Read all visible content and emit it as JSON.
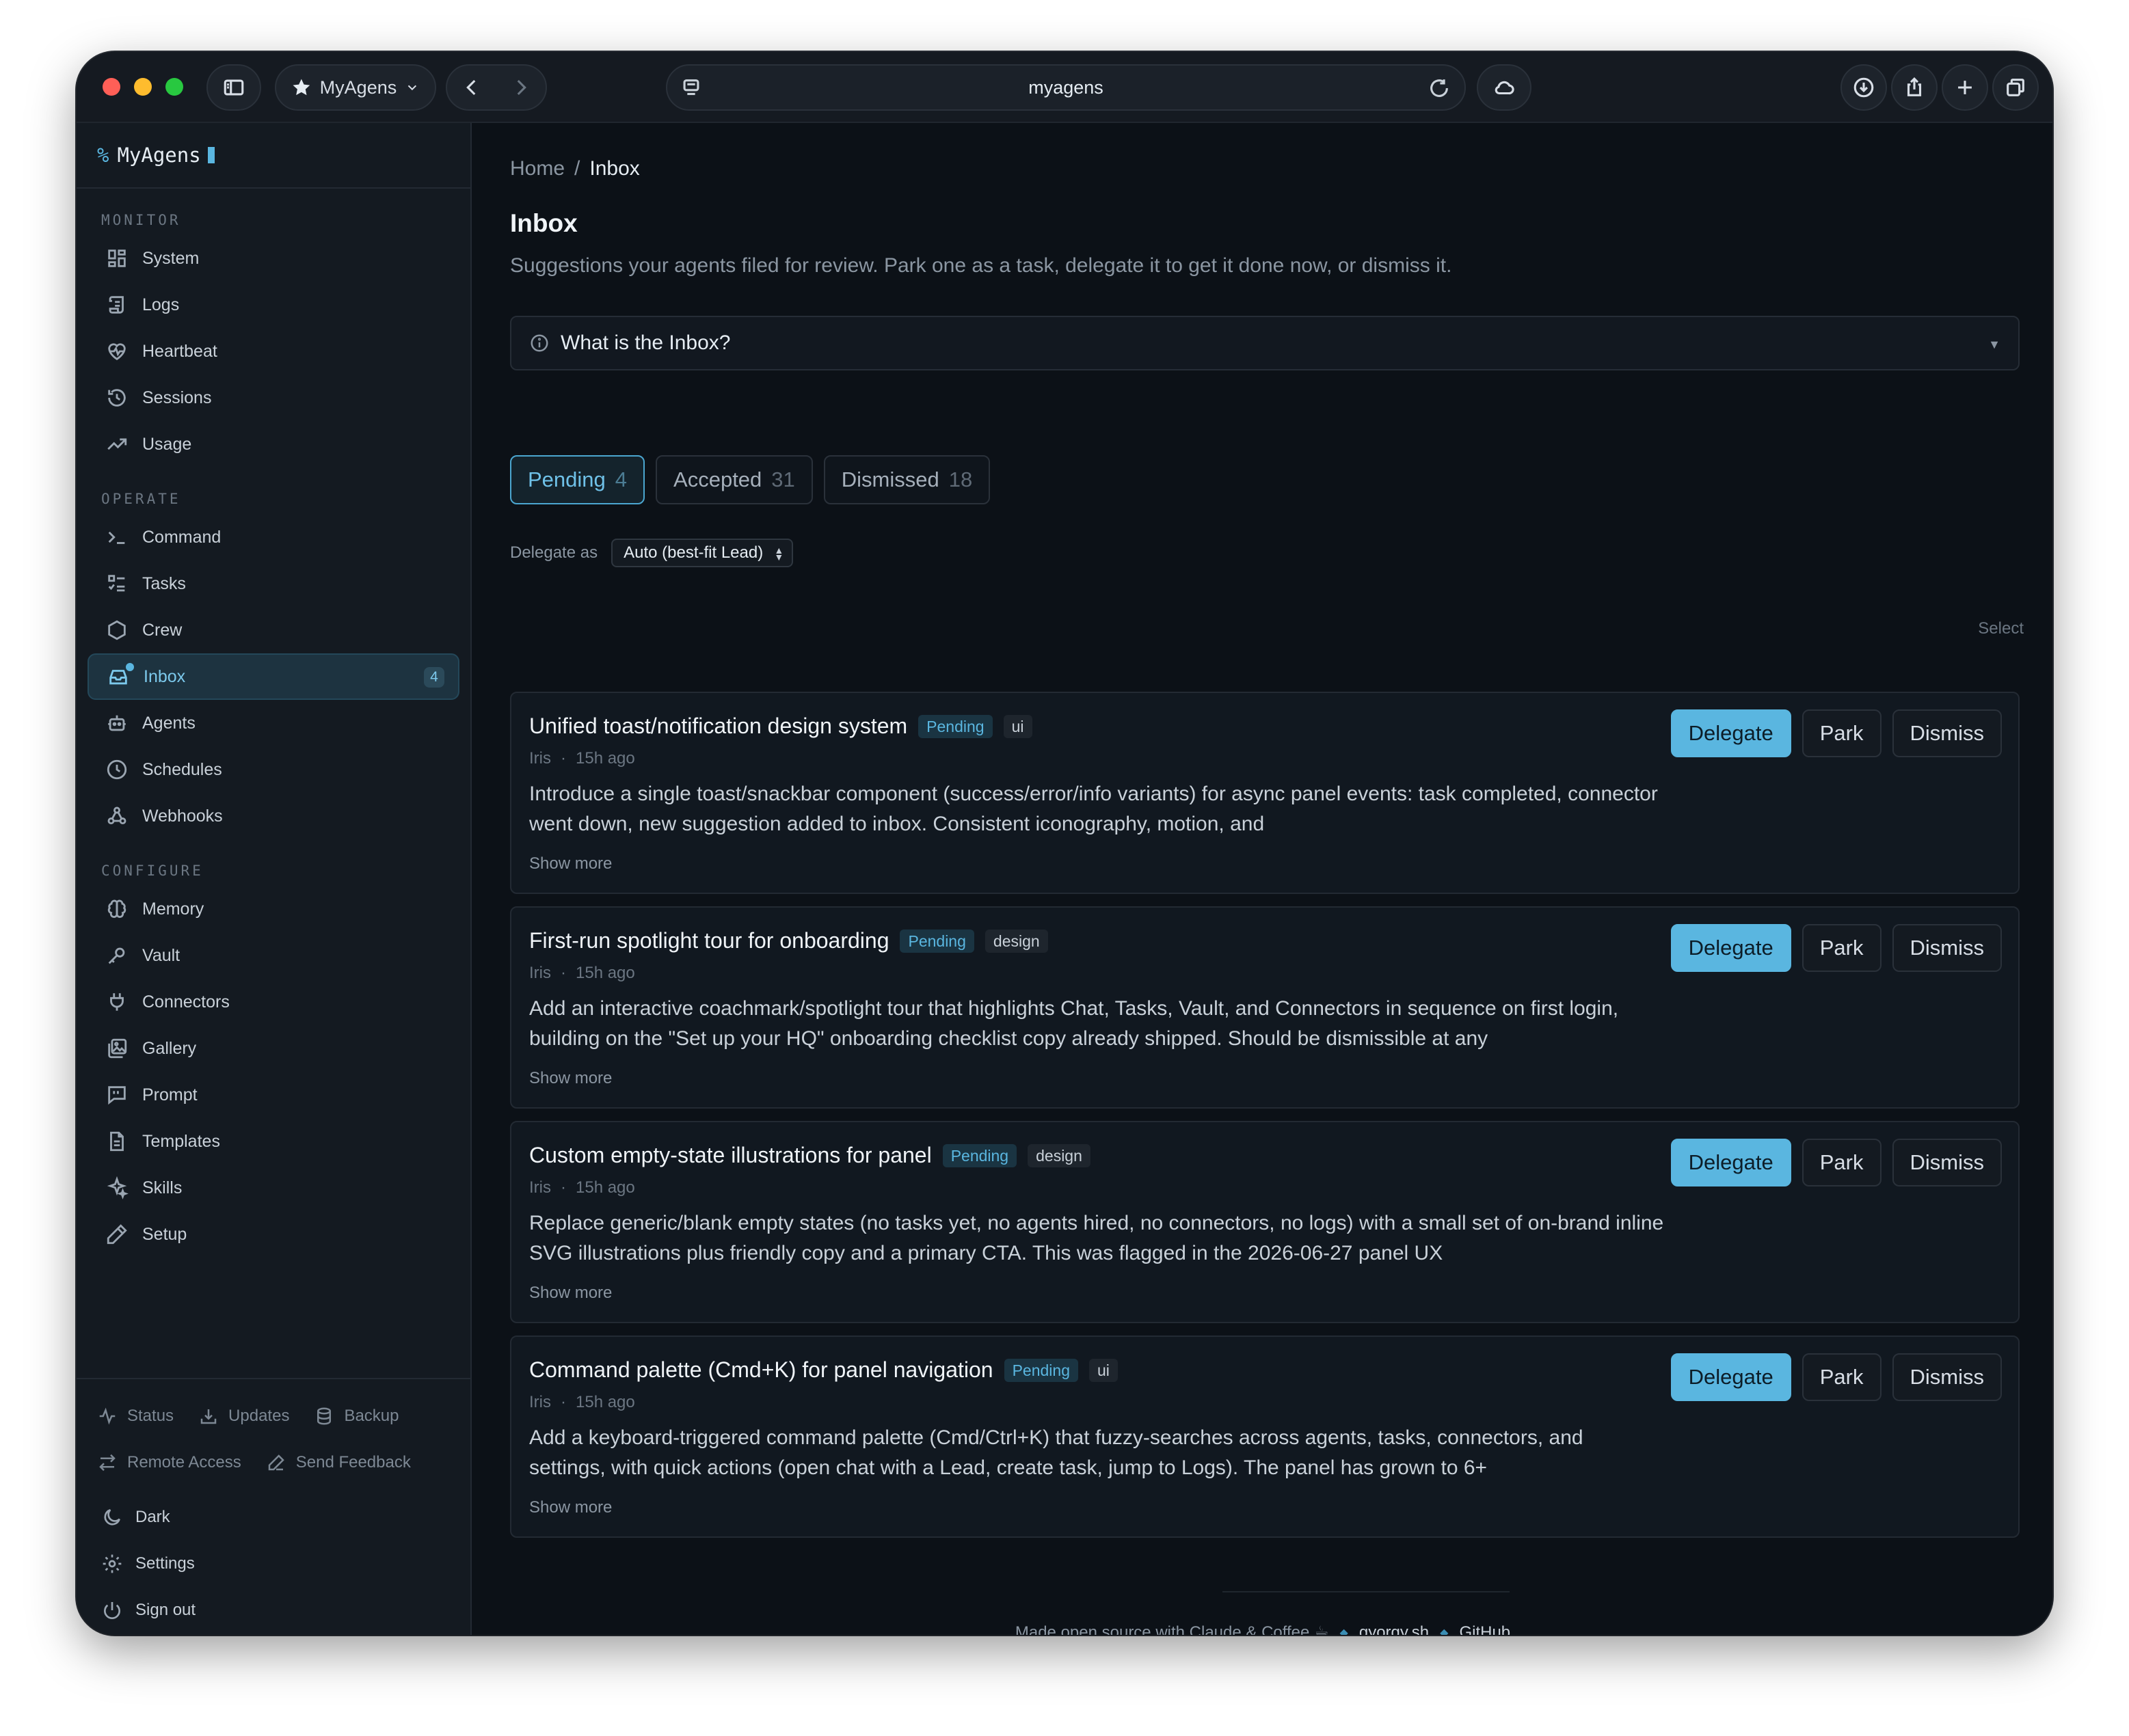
{
  "browser": {
    "profile_label": "MyAgens",
    "url": "myagens"
  },
  "sidebar": {
    "brand": "MyAgens",
    "sections": {
      "monitor": "MONITOR",
      "operate": "OPERATE",
      "configure": "CONFIGURE"
    },
    "monitor_items": [
      "System",
      "Logs",
      "Heartbeat",
      "Sessions",
      "Usage"
    ],
    "operate_items": [
      "Command",
      "Tasks",
      "Crew",
      "Inbox",
      "Agents",
      "Schedules",
      "Webhooks"
    ],
    "configure_items": [
      "Memory",
      "Vault",
      "Connectors",
      "Gallery",
      "Prompt",
      "Templates",
      "Skills",
      "Setup"
    ],
    "inbox_count": "4",
    "footer": {
      "status": "Status",
      "updates": "Updates",
      "backup": "Backup",
      "remote_access": "Remote Access",
      "send_feedback": "Send Feedback",
      "dark": "Dark",
      "settings": "Settings",
      "sign_out": "Sign out"
    }
  },
  "main": {
    "breadcrumb": {
      "home": "Home",
      "sep": "/",
      "current": "Inbox"
    },
    "title": "Inbox",
    "subtitle": "Suggestions your agents filed for review. Park one as a task, delegate it to get it done now, or dismiss it.",
    "info_title": "What is the Inbox?",
    "tabs": [
      {
        "label": "Pending",
        "count": "4"
      },
      {
        "label": "Accepted",
        "count": "31"
      },
      {
        "label": "Dismissed",
        "count": "18"
      }
    ],
    "delegate_label": "Delegate as",
    "delegate_value": "Auto (best-fit Lead)",
    "select_label": "Select",
    "buttons": {
      "delegate": "Delegate",
      "park": "Park",
      "dismiss": "Dismiss",
      "show_more": "Show more"
    },
    "cards": [
      {
        "title": "Unified toast/notification design system",
        "status": "Pending",
        "tag": "ui",
        "author": "Iris",
        "time": "15h ago",
        "description": "Introduce a single toast/snackbar component (success/error/info variants) for async panel events: task completed, connector went down, new suggestion added to inbox. Consistent iconography, motion, and"
      },
      {
        "title": "First-run spotlight tour for onboarding",
        "status": "Pending",
        "tag": "design",
        "author": "Iris",
        "time": "15h ago",
        "description": "Add an interactive coachmark/spotlight tour that highlights Chat, Tasks, Vault, and Connectors in sequence on first login, building on the \"Set up your HQ\" onboarding checklist copy already shipped. Should be dismissible at any"
      },
      {
        "title": "Custom empty-state illustrations for panel",
        "status": "Pending",
        "tag": "design",
        "author": "Iris",
        "time": "15h ago",
        "description": "Replace generic/blank empty states (no tasks yet, no agents hired, no connectors, no logs) with a small set of on-brand inline SVG illustrations plus friendly copy and a primary CTA. This was flagged in the 2026-06-27 panel UX"
      },
      {
        "title": "Command palette (Cmd+K) for panel navigation",
        "status": "Pending",
        "tag": "ui",
        "author": "Iris",
        "time": "15h ago",
        "description": "Add a keyboard-triggered command palette (Cmd/Ctrl+K) that fuzzy-searches across agents, tasks, connectors, and settings, with quick actions (open chat with a Lead, create task, jump to Logs). The panel has grown to 6+"
      }
    ],
    "footer": {
      "made": "Made open source with Claude & Coffee ☕",
      "link1": "gyorgy.sh",
      "link2": "GitHub"
    }
  }
}
